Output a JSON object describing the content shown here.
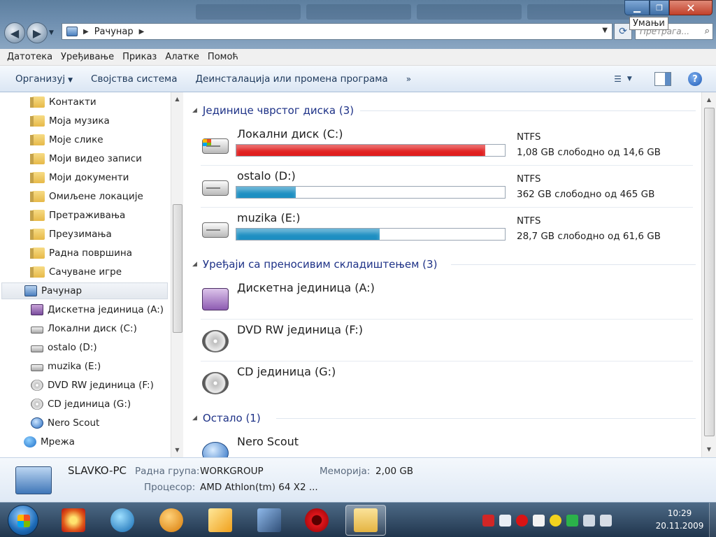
{
  "window": {
    "tooltip": "Умањи",
    "controls": {
      "minimize": "▁",
      "maximize": "❐",
      "close": "✕"
    }
  },
  "address": {
    "segments": [
      "Рачунар"
    ],
    "search_placeholder": "Претрага..."
  },
  "menu": [
    "Датотека",
    "Уређивање",
    "Приказ",
    "Алатке",
    "Помоћ"
  ],
  "commands": {
    "organize": "Организуј",
    "system_properties": "Својства система",
    "uninstall": "Деинсталација или промена програма",
    "more": "»"
  },
  "nav": {
    "items": [
      {
        "label": "Контакти",
        "icon": "folder-icon"
      },
      {
        "label": "Моја музика",
        "icon": "folder-icon"
      },
      {
        "label": "Моје слике",
        "icon": "folder-icon"
      },
      {
        "label": "Моји видео записи",
        "icon": "folder-icon"
      },
      {
        "label": "Моји документи",
        "icon": "folder-icon"
      },
      {
        "label": "Омиљене локације",
        "icon": "folder-icon"
      },
      {
        "label": "Претраживања",
        "icon": "folder-icon"
      },
      {
        "label": "Преузимања",
        "icon": "folder-icon"
      },
      {
        "label": "Радна површина",
        "icon": "folder-icon"
      },
      {
        "label": "Сачуване игре",
        "icon": "folder-icon"
      }
    ],
    "computer": "Рачунар",
    "drives": [
      {
        "label": "Дискетна јединица (A:)",
        "icon": "floppy-icon"
      },
      {
        "label": "Локални диск (C:)",
        "icon": "windows-drive-icon"
      },
      {
        "label": "ostalo (D:)",
        "icon": "drive-icon"
      },
      {
        "label": "muzika (E:)",
        "icon": "drive-icon"
      },
      {
        "label": "DVD RW јединица (F:)",
        "icon": "dvd-icon"
      },
      {
        "label": "CD јединица (G:)",
        "icon": "cd-icon"
      },
      {
        "label": "Nero Scout",
        "icon": "nero-scout-icon"
      }
    ],
    "network": "Мрежа"
  },
  "groups": {
    "hdd": "Јединице чврстог диска (3)",
    "removable": "Уређаји са преносивим складиштењем (3)",
    "other": "Остало (1)"
  },
  "hard_drives": [
    {
      "name": "Локални диск (C:)",
      "fs": "NTFS",
      "free": "1,08 GB слободно од 14,6 GB",
      "used_fraction": 0.926,
      "color": "#e01f1f"
    },
    {
      "name": "ostalo (D:)",
      "fs": "NTFS",
      "free": "362 GB слободно од 465 GB",
      "used_fraction": 0.221,
      "color": "#1d8fc2"
    },
    {
      "name": "muzika (E:)",
      "fs": "NTFS",
      "free": "28,7 GB слободно од 61,6 GB",
      "used_fraction": 0.534,
      "color": "#1d8fc2"
    }
  ],
  "removable": [
    {
      "name": "Дискетна јединица (A:)"
    },
    {
      "name": "DVD RW јединица (F:)"
    },
    {
      "name": "CD јединица (G:)"
    }
  ],
  "other": [
    {
      "name": "Nero Scout"
    }
  ],
  "details": {
    "pc_name": "SLAVKO-PC",
    "workgroup_label": "Радна група:",
    "workgroup": "WORKGROUP",
    "memory_label": "Меморија:",
    "memory": "2,00 GB",
    "cpu_label": "Процесор:",
    "cpu": "AMD Athlon(tm) 64 X2 ..."
  },
  "taskbar": {
    "time": "10:29",
    "date": "20.11.2009"
  }
}
